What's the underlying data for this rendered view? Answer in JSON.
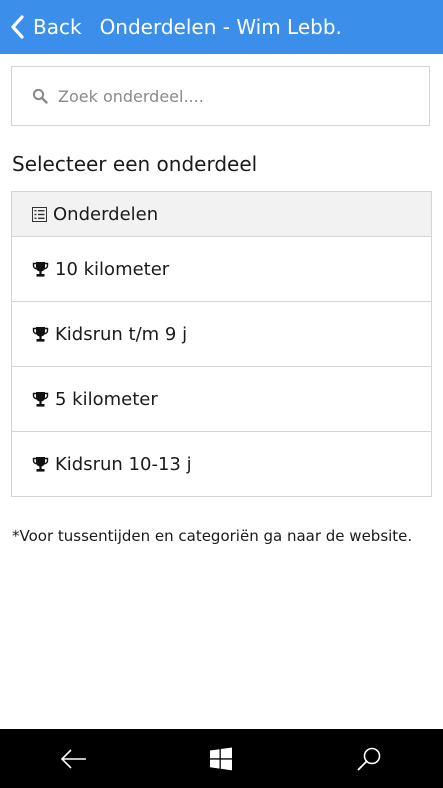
{
  "header": {
    "back_label": "Back",
    "title": "Onderdelen - Wim Lebb..."
  },
  "search": {
    "placeholder": "Zoek onderdeel....",
    "value": ""
  },
  "section_title": "Selecteer een onderdeel",
  "list": {
    "header_label": "Onderdelen",
    "items": [
      {
        "label": "10 kilometer",
        "icon": "trophy-icon"
      },
      {
        "label": "Kidsrun t/m 9 j",
        "icon": "trophy-icon"
      },
      {
        "label": "5 kilometer",
        "icon": "trophy-icon"
      },
      {
        "label": "Kidsrun 10-13 j",
        "icon": "trophy-icon"
      }
    ]
  },
  "note": "*Voor tussentijden en categoriën ga naar de website.",
  "navbar": {
    "buttons": [
      "back-arrow-icon",
      "windows-icon",
      "search-icon"
    ]
  },
  "colors": {
    "header_bg": "#3b8eea",
    "navbar_bg": "#000000",
    "list_header_bg": "#f2f2f2"
  }
}
